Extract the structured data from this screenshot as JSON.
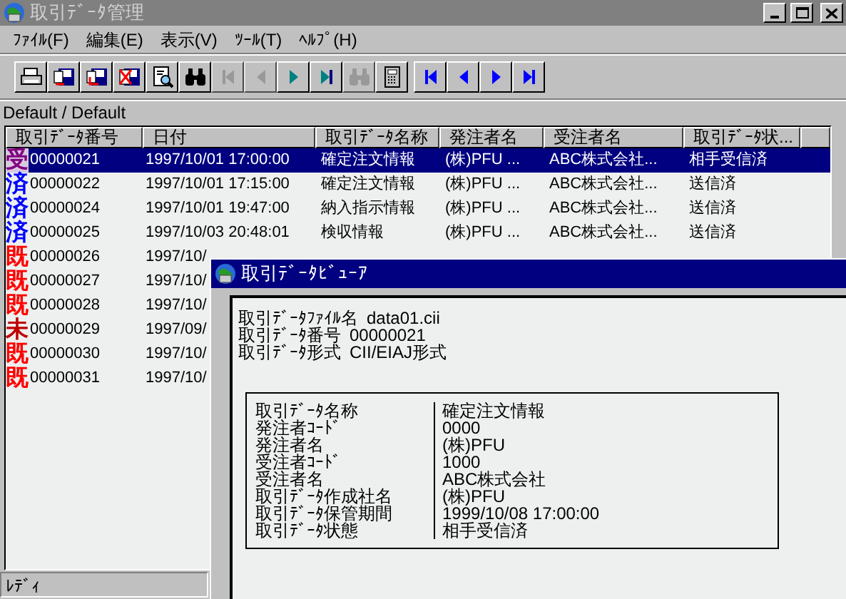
{
  "window": {
    "title": "取引ﾃﾞｰﾀ管理"
  },
  "menu": [
    "ﾌｧｲﾙ(F)",
    "編集(E)",
    "表示(V)",
    "ﾂｰﾙ(T)",
    "ﾍﾙﾌﾟ(H)"
  ],
  "toolbar": [
    {
      "kind": "print",
      "disabled": false
    },
    {
      "kind": "export",
      "disabled": false
    },
    {
      "kind": "import",
      "disabled": false
    },
    {
      "kind": "delete",
      "disabled": false
    },
    {
      "kind": "preview",
      "disabled": false
    },
    {
      "kind": "find",
      "disabled": false
    },
    {
      "kind": "first",
      "disabled": true
    },
    {
      "kind": "prev",
      "disabled": true
    },
    {
      "kind": "next",
      "disabled": false
    },
    {
      "kind": "last",
      "disabled": false
    },
    {
      "kind": "find",
      "disabled": true
    },
    {
      "kind": "calc",
      "disabled": false
    }
  ],
  "nav_toolbar": [
    {
      "kind": "first",
      "disabled": false
    },
    {
      "kind": "prev",
      "disabled": false
    },
    {
      "kind": "next",
      "disabled": false
    },
    {
      "kind": "last",
      "disabled": false
    }
  ],
  "path": "Default / Default",
  "table": {
    "columns": [
      "取引ﾃﾞｰﾀ番号",
      "日付",
      "取引ﾃﾞｰﾀ名称",
      "発注者名",
      "受注者名",
      "取引ﾃﾞｰﾀ状..."
    ],
    "rows": [
      {
        "mark": "受",
        "color": "#800080",
        "number": "00000021",
        "date": "1997/10/01 17:00:00",
        "name": "確定注文情報",
        "orderer": "(株)PFU ...",
        "receiver": "ABC株式会社...",
        "status": "相手受信済",
        "selected": true
      },
      {
        "mark": "済",
        "color": "#0000ff",
        "number": "00000022",
        "date": "1997/10/01 17:15:00",
        "name": "確定注文情報",
        "orderer": "(株)PFU ...",
        "receiver": "ABC株式会社...",
        "status": "送信済",
        "selected": false
      },
      {
        "mark": "済",
        "color": "#0000ff",
        "number": "00000024",
        "date": "1997/10/01 19:47:00",
        "name": "納入指示情報",
        "orderer": "(株)PFU ...",
        "receiver": "ABC株式会社...",
        "status": "送信済",
        "selected": false
      },
      {
        "mark": "済",
        "color": "#0000ff",
        "number": "00000025",
        "date": "1997/10/03 20:48:01",
        "name": "検収情報",
        "orderer": "(株)PFU ...",
        "receiver": "ABC株式会社...",
        "status": "送信済",
        "selected": false
      },
      {
        "mark": "既",
        "color": "#ff0000",
        "number": "00000026",
        "date": "1997/10/",
        "selected": false
      },
      {
        "mark": "既",
        "color": "#ff0000",
        "number": "00000027",
        "date": "1997/10/",
        "selected": false
      },
      {
        "mark": "既",
        "color": "#ff0000",
        "number": "00000028",
        "date": "1997/10/",
        "selected": false
      },
      {
        "mark": "未",
        "color": "#c00000",
        "number": "00000029",
        "date": "1997/09/",
        "selected": false
      },
      {
        "mark": "既",
        "color": "#ff0000",
        "number": "00000030",
        "date": "1997/10/",
        "selected": false
      },
      {
        "mark": "既",
        "color": "#ff0000",
        "number": "00000031",
        "date": "1997/10/",
        "selected": false
      }
    ]
  },
  "status_bar": "ﾚﾃﾞｨ",
  "viewer": {
    "title": "取引ﾃﾞｰﾀﾋﾞｭｰｱ",
    "info": [
      {
        "label": "取引ﾃﾞｰﾀﾌｧｲﾙ名",
        "value": "data01.cii"
      },
      {
        "label": "取引ﾃﾞｰﾀ番号",
        "value": "00000021"
      },
      {
        "label": "取引ﾃﾞｰﾀ形式",
        "value": "CII/EIAJ形式"
      }
    ],
    "details": [
      {
        "label": "取引ﾃﾞｰﾀ名称",
        "value": "確定注文情報"
      },
      {
        "label": "発注者ｺｰﾄﾞ",
        "value": "0000"
      },
      {
        "label": "発注者名",
        "value": "(株)PFU"
      },
      {
        "label": "受注者ｺｰﾄﾞ",
        "value": "1000"
      },
      {
        "label": "受注者名",
        "value": "ABC株式会社"
      },
      {
        "label": "取引ﾃﾞｰﾀ作成社名",
        "value": "(株)PFU"
      },
      {
        "label": "取引ﾃﾞｰﾀ保管期間",
        "value": "1999/10/08 17:00:00"
      },
      {
        "label": "取引ﾃﾞｰﾀ状態",
        "value": "相手受信済"
      }
    ]
  }
}
